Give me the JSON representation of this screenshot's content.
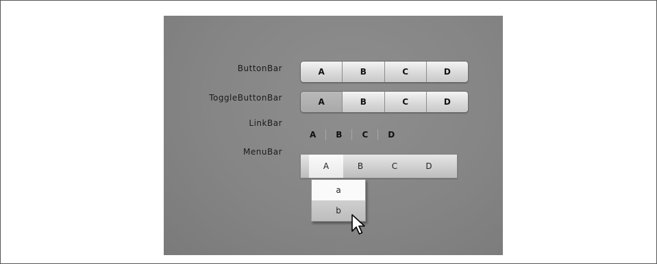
{
  "rows": {
    "buttonbar_label": "ButtonBar",
    "togglebuttonbar_label": "ToggleButtonBar",
    "linkbar_label": "LinkBar",
    "menubar_label": "MenuBar"
  },
  "buttonbar": {
    "items": [
      "A",
      "B",
      "C",
      "D"
    ]
  },
  "togglebuttonbar": {
    "items": [
      "A",
      "B",
      "C",
      "D"
    ],
    "selected": "A"
  },
  "linkbar": {
    "items": [
      "A",
      "B",
      "C",
      "D"
    ]
  },
  "menubar": {
    "items": [
      "A",
      "B",
      "C",
      "D"
    ],
    "open": "A",
    "submenu": [
      "a",
      "b"
    ],
    "highlighted": "b"
  },
  "icons": {
    "cursor": "arrow-cursor-icon"
  }
}
